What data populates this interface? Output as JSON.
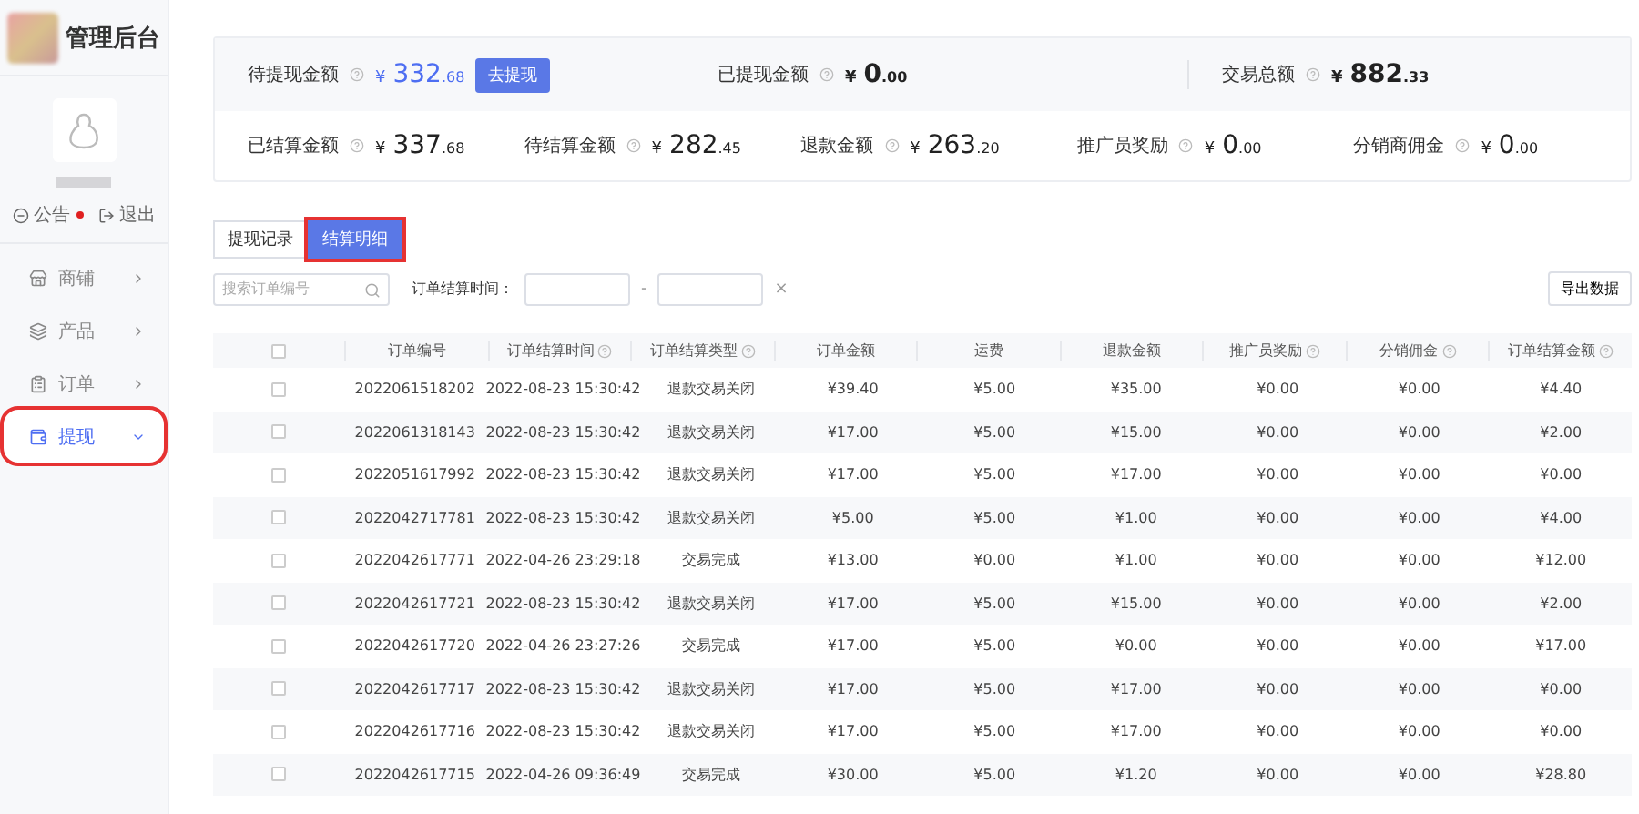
{
  "sidebar": {
    "title": "管理后台",
    "links": [
      {
        "kind": "notice",
        "label": "公告",
        "dot": true
      },
      {
        "kind": "logout",
        "label": "退出",
        "dot": false
      }
    ],
    "menu": [
      {
        "kind": "store",
        "label": "商铺",
        "expanded": false,
        "selected": false,
        "outlined": false
      },
      {
        "kind": "product",
        "label": "产品",
        "expanded": false,
        "selected": false,
        "outlined": false
      },
      {
        "kind": "order",
        "label": "订单",
        "expanded": false,
        "selected": false,
        "outlined": false
      },
      {
        "kind": "withdraw",
        "label": "提现",
        "expanded": true,
        "selected": true,
        "outlined": true
      }
    ]
  },
  "summary": {
    "top": [
      {
        "label": "待提现金额",
        "currency": "¥",
        "int": "332",
        "dec": ".68",
        "accent": true,
        "button": "去提现"
      },
      {
        "label": "已提现金额",
        "currency": "¥",
        "int": "0",
        "dec": ".00",
        "accent": false
      },
      {
        "label": "交易总额",
        "currency": "¥",
        "int": "882",
        "dec": ".33",
        "accent": false
      }
    ],
    "bottom": [
      {
        "label": "已结算金额",
        "currency": "¥",
        "int": "337",
        "dec": ".68"
      },
      {
        "label": "待结算金额",
        "currency": "¥",
        "int": "282",
        "dec": ".45"
      },
      {
        "label": "退款金额",
        "currency": "¥",
        "int": "263",
        "dec": ".20"
      },
      {
        "label": "推广员奖励",
        "currency": "¥",
        "int": "0",
        "dec": ".00"
      },
      {
        "label": "分销商佣金",
        "currency": "¥",
        "int": "0",
        "dec": ".00"
      }
    ]
  },
  "tabs": [
    {
      "label": "提现记录",
      "selected": false,
      "outlined": false
    },
    {
      "label": "结算明细",
      "selected": true,
      "outlined": true
    }
  ],
  "filter": {
    "search_placeholder": "搜索订单编号",
    "date_label": "订单结算时间：",
    "separator": "-",
    "clear": "×",
    "export": "导出数据"
  },
  "table": {
    "select_all_checked": false,
    "columns": [
      {
        "label": "订单编号",
        "help": false
      },
      {
        "label": "订单结算时间",
        "help": true
      },
      {
        "label": "订单结算类型",
        "help": true
      },
      {
        "label": "订单金额",
        "help": false
      },
      {
        "label": "运费",
        "help": false
      },
      {
        "label": "退款金额",
        "help": false
      },
      {
        "label": "推广员奖励",
        "help": true
      },
      {
        "label": "分销佣金",
        "help": true
      },
      {
        "label": "订单结算金额",
        "help": true
      }
    ],
    "rows": [
      {
        "checked": false,
        "cells": [
          "2022061518202",
          "2022-08-23 15:30:42",
          "退款交易关闭",
          "¥39.40",
          "¥5.00",
          "¥35.00",
          "¥0.00",
          "¥0.00",
          "¥4.40"
        ]
      },
      {
        "checked": false,
        "cells": [
          "2022061318143",
          "2022-08-23 15:30:42",
          "退款交易关闭",
          "¥17.00",
          "¥5.00",
          "¥15.00",
          "¥0.00",
          "¥0.00",
          "¥2.00"
        ]
      },
      {
        "checked": false,
        "cells": [
          "2022051617992",
          "2022-08-23 15:30:42",
          "退款交易关闭",
          "¥17.00",
          "¥5.00",
          "¥17.00",
          "¥0.00",
          "¥0.00",
          "¥0.00"
        ]
      },
      {
        "checked": false,
        "cells": [
          "2022042717781",
          "2022-08-23 15:30:42",
          "退款交易关闭",
          "¥5.00",
          "¥5.00",
          "¥1.00",
          "¥0.00",
          "¥0.00",
          "¥4.00"
        ]
      },
      {
        "checked": false,
        "cells": [
          "2022042617771",
          "2022-04-26 23:29:18",
          "交易完成",
          "¥13.00",
          "¥0.00",
          "¥1.00",
          "¥0.00",
          "¥0.00",
          "¥12.00"
        ]
      },
      {
        "checked": false,
        "cells": [
          "2022042617721",
          "2022-08-23 15:30:42",
          "退款交易关闭",
          "¥17.00",
          "¥5.00",
          "¥15.00",
          "¥0.00",
          "¥0.00",
          "¥2.00"
        ]
      },
      {
        "checked": false,
        "cells": [
          "2022042617720",
          "2022-04-26 23:27:26",
          "交易完成",
          "¥17.00",
          "¥5.00",
          "¥0.00",
          "¥0.00",
          "¥0.00",
          "¥17.00"
        ]
      },
      {
        "checked": false,
        "cells": [
          "2022042617717",
          "2022-08-23 15:30:42",
          "退款交易关闭",
          "¥17.00",
          "¥5.00",
          "¥17.00",
          "¥0.00",
          "¥0.00",
          "¥0.00"
        ]
      },
      {
        "checked": false,
        "cells": [
          "2022042617716",
          "2022-08-23 15:30:42",
          "退款交易关闭",
          "¥17.00",
          "¥5.00",
          "¥17.00",
          "¥0.00",
          "¥0.00",
          "¥0.00"
        ]
      },
      {
        "checked": false,
        "cells": [
          "2022042617715",
          "2022-04-26 09:36:49",
          "交易完成",
          "¥30.00",
          "¥5.00",
          "¥1.20",
          "¥0.00",
          "¥0.00",
          "¥28.80"
        ]
      }
    ]
  }
}
